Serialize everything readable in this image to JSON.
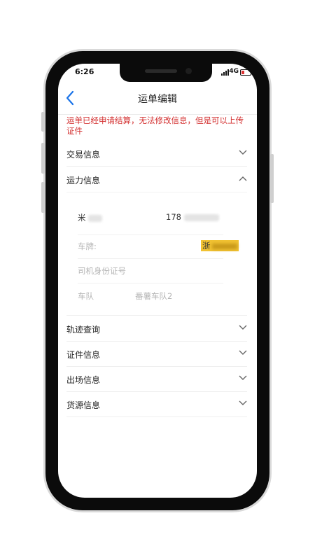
{
  "status_bar": {
    "time": "6:26",
    "network": "4G"
  },
  "navbar": {
    "title": "运单编辑"
  },
  "notice": "运单已经申请结算，无法修改信息，但是可以上传证件",
  "sections": {
    "trade_info": "交易信息",
    "capacity_info": "运力信息",
    "track_query": "轨迹查询",
    "document_info": "证件信息",
    "exit_info": "出场信息",
    "cargo_info": "货源信息"
  },
  "capacity": {
    "driver_name": "米",
    "driver_phone": "178",
    "plate_label": "车牌:",
    "plate_value": "浙",
    "driver_id_label": "司机身份证号",
    "fleet_label": "车队",
    "fleet_value": "番薯车队2"
  },
  "colors": {
    "accent": "#1a73e8",
    "notice": "#d32f2f",
    "plate_highlight": "#f1c232"
  }
}
